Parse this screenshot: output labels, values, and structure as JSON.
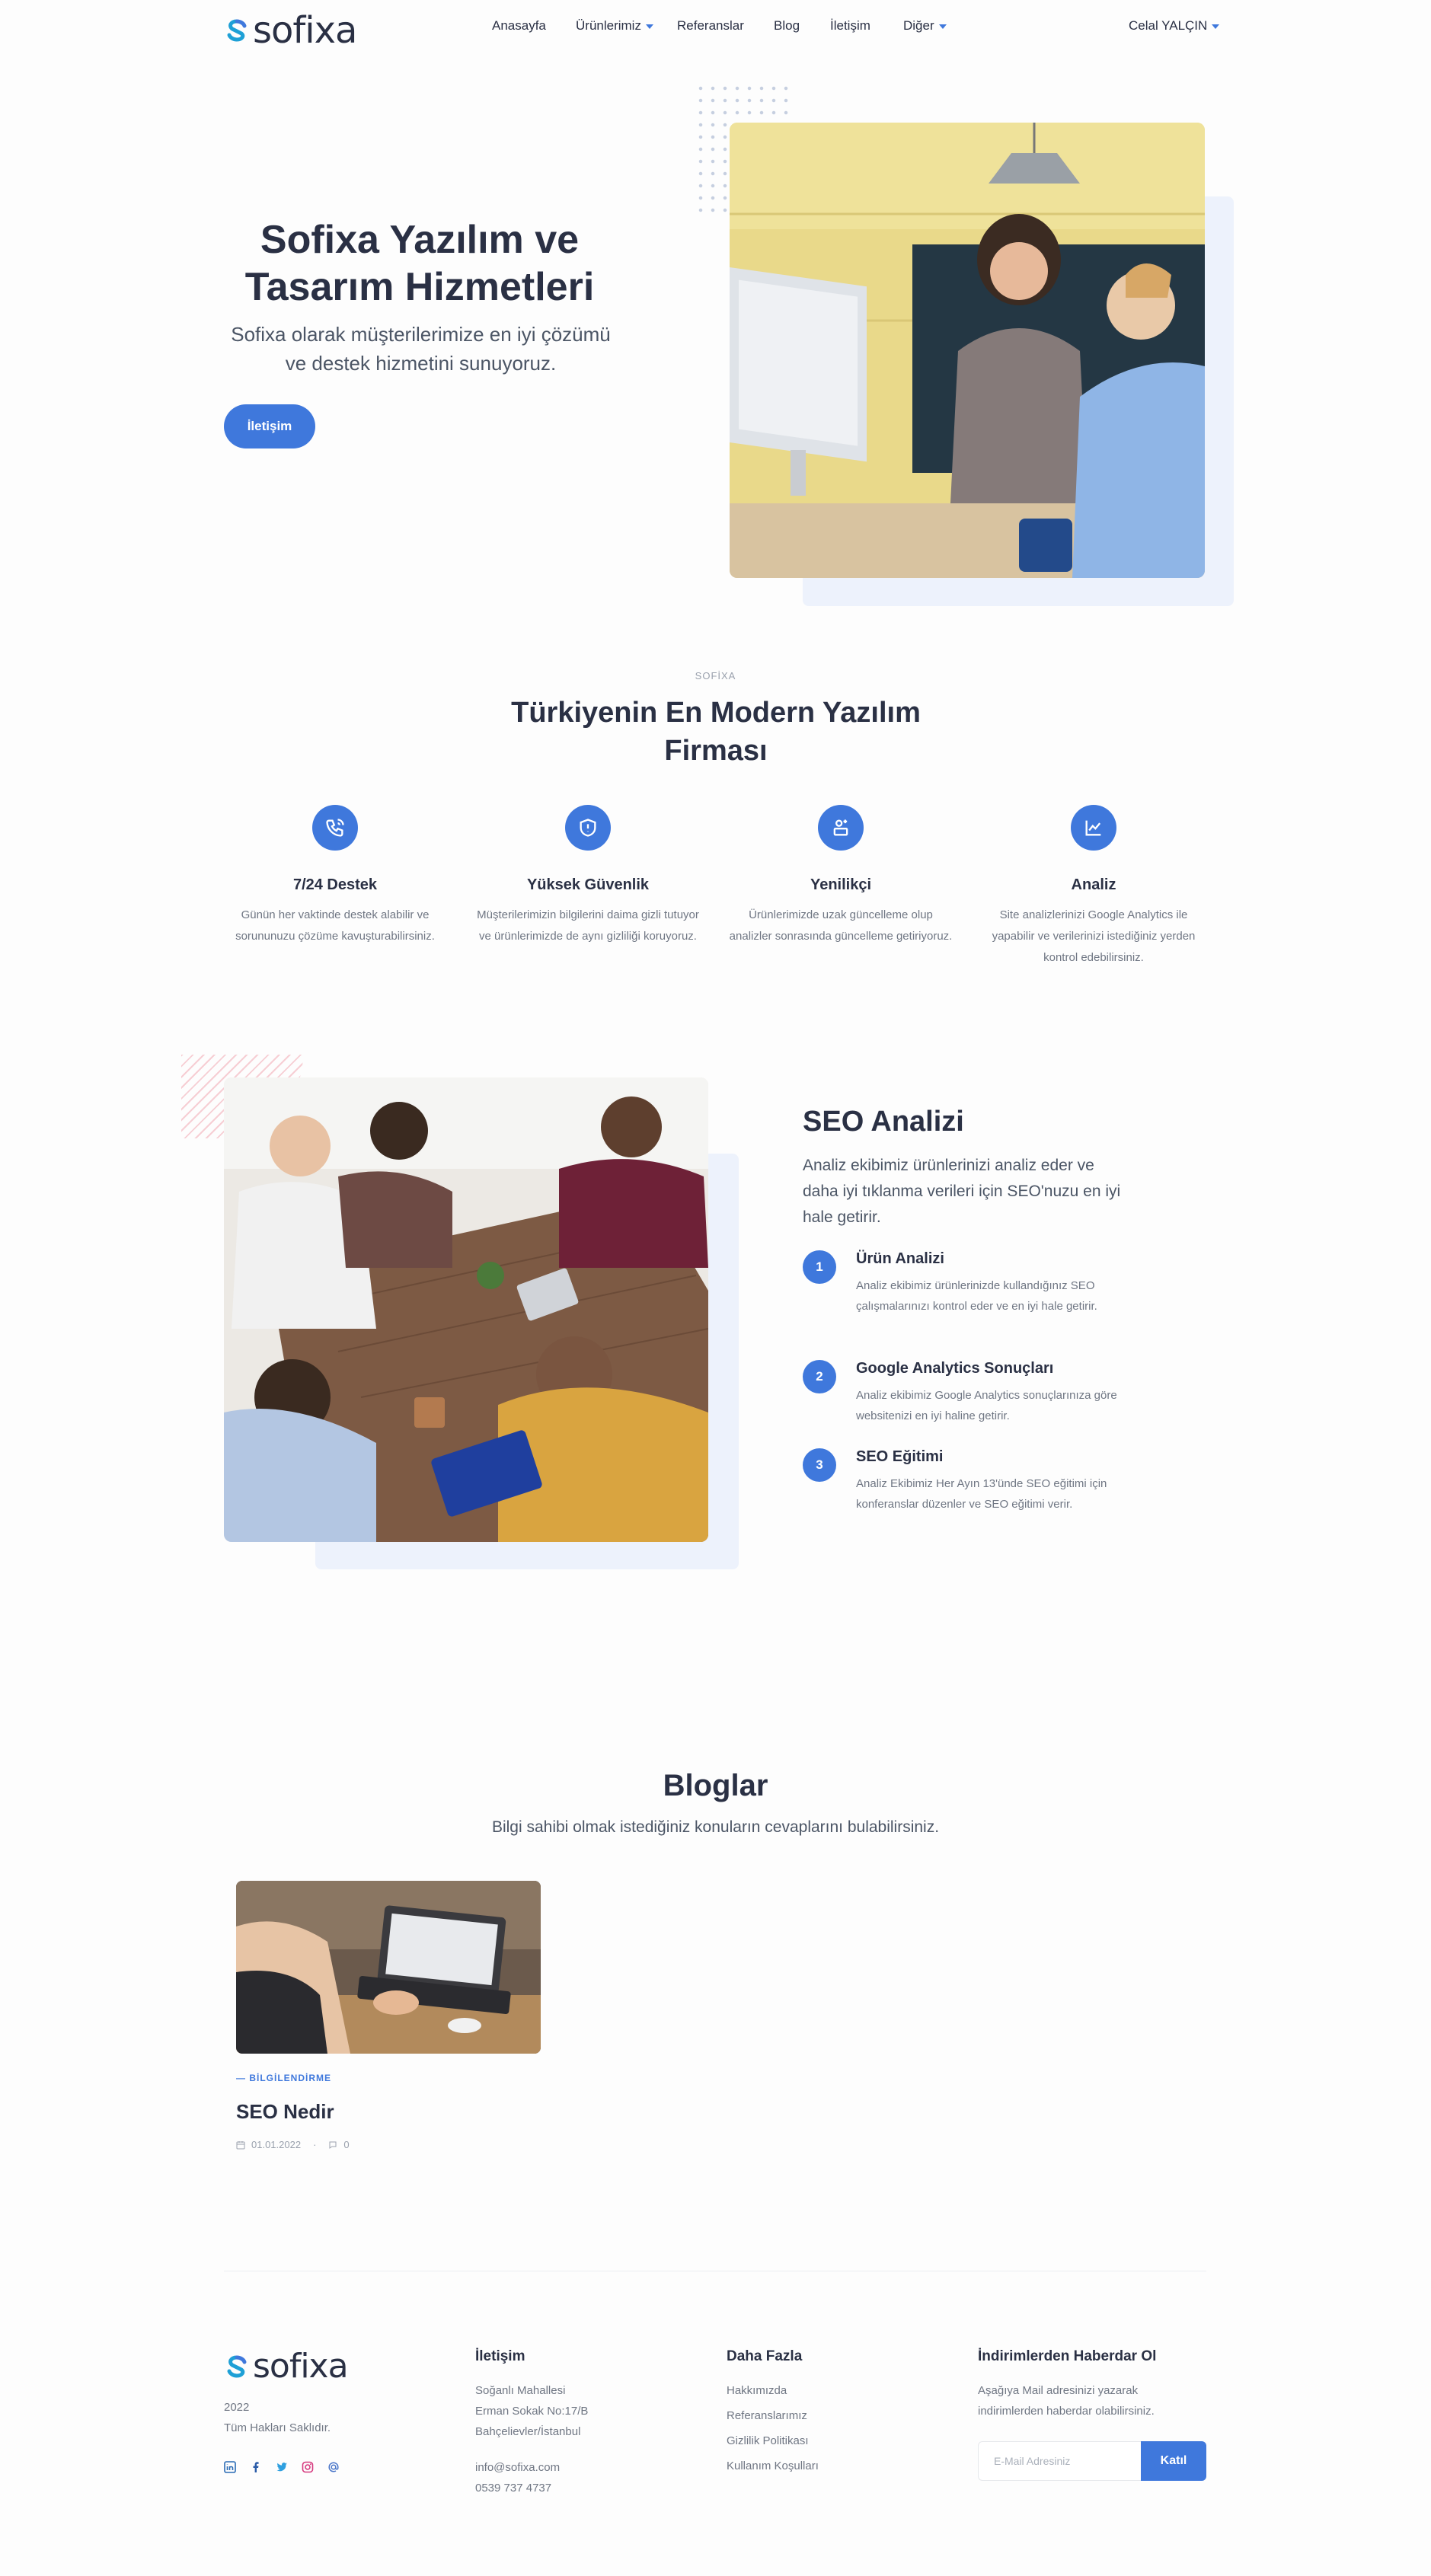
{
  "nav": {
    "logo_text": "sofixa",
    "links": [
      "Anasayfa",
      "Ürünlerimiz",
      "Referanslar",
      "Blog",
      "İletişim",
      "Diğer"
    ],
    "user": "Celal YALÇIN"
  },
  "hero": {
    "title": "Sofixa Yazılım ve Tasarım Hizmetleri",
    "subtitle": "Sofixa olarak müşterilerimize en iyi çözümü ve destek hizmetini sunuyoruz.",
    "button": "İletişim"
  },
  "features": {
    "eyebrow": "SOFİXA",
    "title": "Türkiyenin En Modern Yazılım Firması",
    "items": [
      {
        "icon": "phone-support-icon",
        "title": "7/24 Destek",
        "text": "Günün her vaktinde destek alabilir ve sorununuzu çözüme kavuşturabilirsiniz."
      },
      {
        "icon": "shield-icon",
        "title": "Yüksek Güvenlik",
        "text": "Müşterilerimizin bilgilerini daima gizli tutuyor ve ürünlerimizde de aynı gizliliği koruyoruz."
      },
      {
        "icon": "innovation-icon",
        "title": "Yenilikçi",
        "text": "Ürünlerimizde uzak güncelleme olup analizler sonrasında güncelleme getiriyoruz."
      },
      {
        "icon": "chart-icon",
        "title": "Analiz",
        "text": "Site analizlerinizi Google Analytics ile yapabilir ve verilerinizi istediğiniz yerden kontrol edebilirsiniz."
      }
    ]
  },
  "seo": {
    "title": "SEO Analizi",
    "description": "Analiz ekibimiz ürünlerinizi analiz eder ve daha iyi tıklanma verileri için SEO'nuzu en iyi hale getirir.",
    "steps": [
      {
        "num": "1",
        "title": "Ürün Analizi",
        "text": "Analiz ekibimiz ürünlerinizde kullandığınız SEO çalışmalarınızı kontrol eder ve en iyi hale getirir."
      },
      {
        "num": "2",
        "title": "Google Analytics Sonuçları",
        "text": "Analiz ekibimiz Google Analytics sonuçlarınıza göre websitenizi en iyi haline getirir."
      },
      {
        "num": "3",
        "title": "SEO Eğitimi",
        "text": "Analiz Ekibimiz Her Ayın 13'ünde SEO eğitimi için konferanslar düzenler ve SEO eğitimi verir."
      }
    ]
  },
  "blog": {
    "title": "Bloglar",
    "subtitle": "Bilgi sahibi olmak istediğiniz konuların cevaplarını bulabilirsiniz.",
    "card": {
      "category": "— BİLGİLENDİRME",
      "title": "SEO Nedir",
      "date": "01.01.2022",
      "comments": "0"
    }
  },
  "footer": {
    "logo_text": "sofixa",
    "year": "2022",
    "rights": "Tüm Hakları Saklıdır.",
    "contact_title": "İletişim",
    "address": [
      "Soğanlı Mahallesi",
      "Erman Sokak No:17/B",
      "Bahçelievler/İstanbul"
    ],
    "email": "info@sofixa.com",
    "phone": "0539 737 4737",
    "more_title": "Daha Fazla",
    "more_links": [
      "Hakkımızda",
      "Referanslarımız",
      "Gizlilik Politikası",
      "Kullanım Koşulları"
    ],
    "newsletter_title": "İndirimlerden Haberdar Ol",
    "newsletter_text": "Aşağıya Mail adresinizi yazarak indirimlerden haberdar olabilirsiniz.",
    "email_placeholder": "E-Mail Adresiniz",
    "join_button": "Katıl"
  },
  "colors": {
    "accent": "#3f78dc",
    "light_panel": "#edf2fc"
  }
}
